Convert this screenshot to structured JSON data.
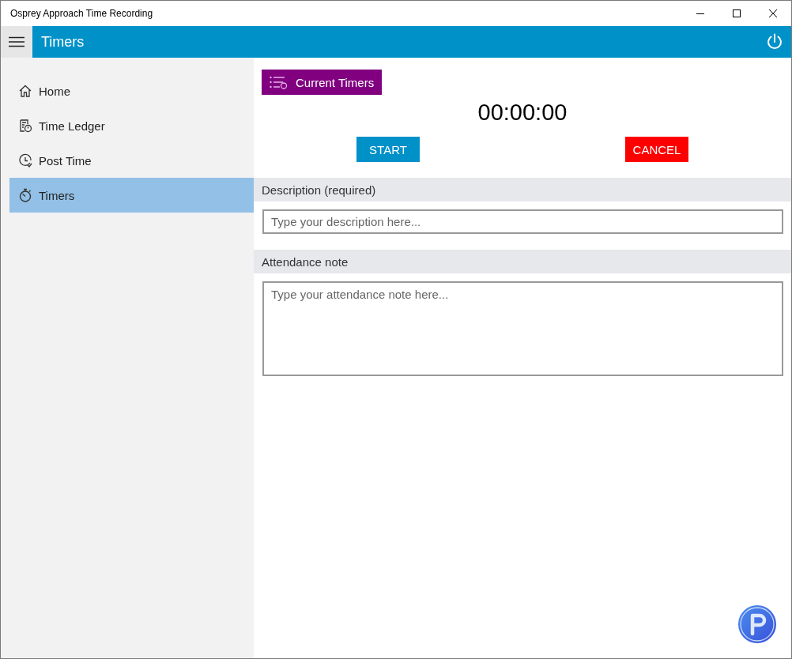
{
  "window": {
    "title": "Osprey Approach Time Recording"
  },
  "header": {
    "title": "Timers"
  },
  "sidebar": {
    "items": [
      {
        "label": "Home",
        "selected": false
      },
      {
        "label": "Time Ledger",
        "selected": false
      },
      {
        "label": "Post Time",
        "selected": false
      },
      {
        "label": "Timers",
        "selected": true
      }
    ]
  },
  "timer": {
    "current_timers_button": "Current Timers",
    "elapsed": "00:00:00",
    "buttons": [
      {
        "label": "START",
        "kind": "start"
      },
      {
        "label": "CANCEL",
        "kind": "cancel"
      }
    ]
  },
  "fields": [
    {
      "label": "Description (required)",
      "placeholder": "Type your description here...",
      "kind": "single"
    },
    {
      "label": "Attendance note",
      "placeholder": "Type your attendance note here...",
      "kind": "multi"
    }
  ]
}
